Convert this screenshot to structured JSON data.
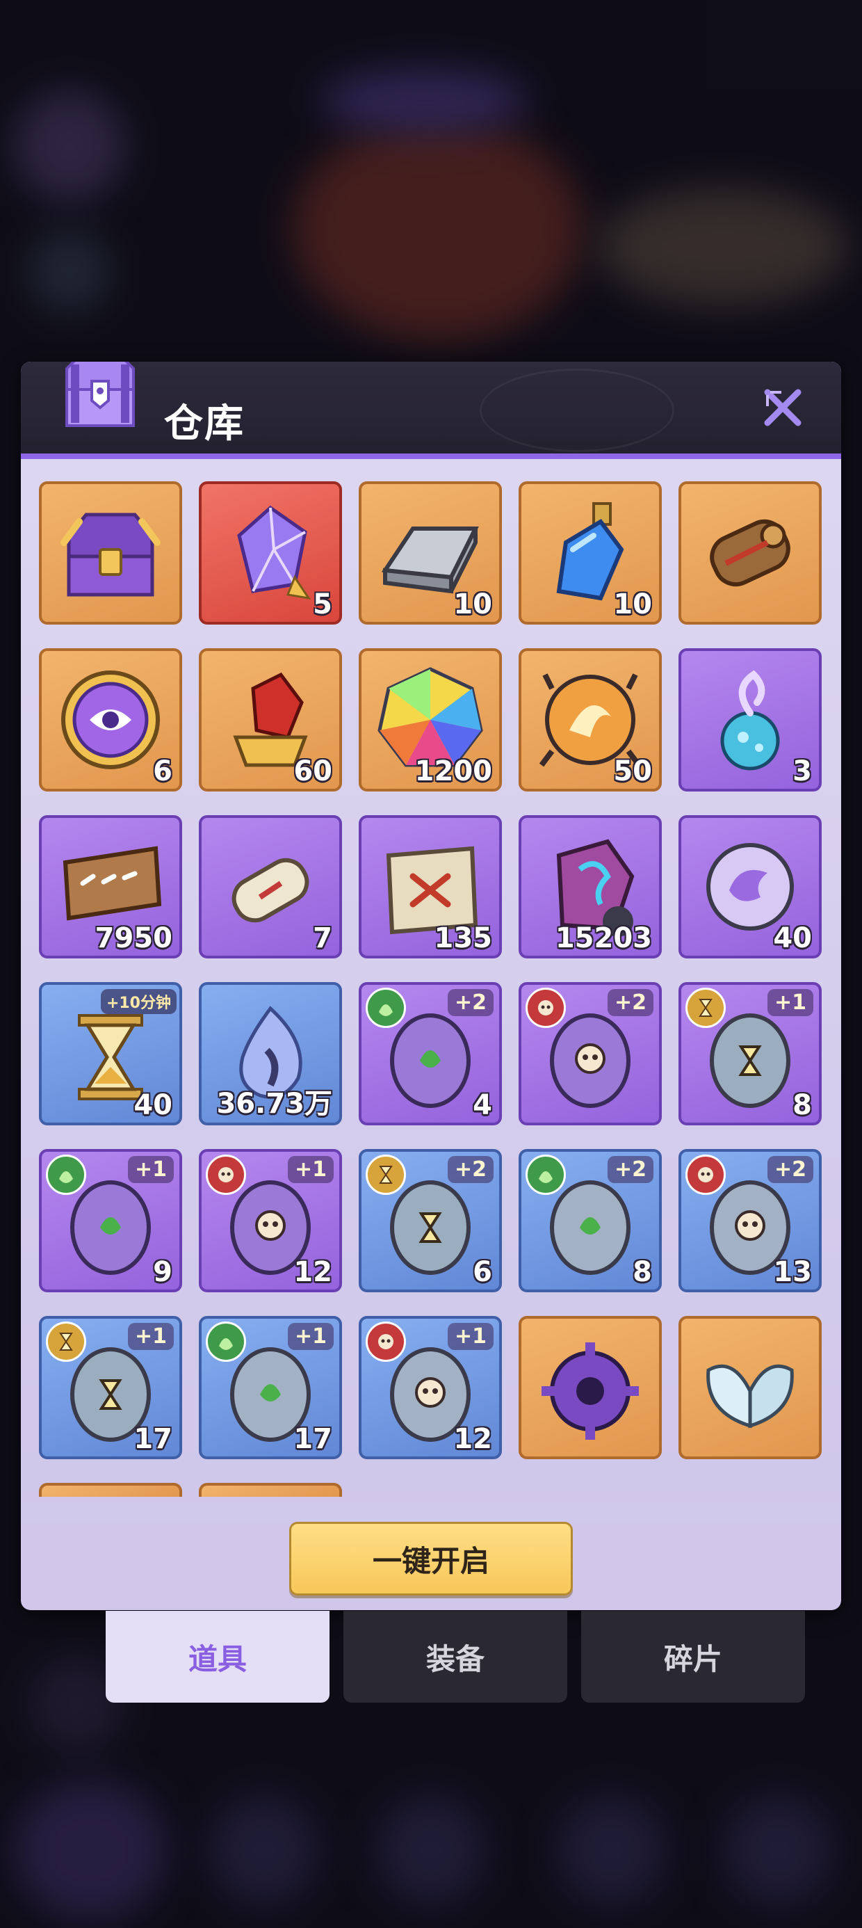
{
  "panel": {
    "title": "仓库",
    "open_all_label": "一键开启"
  },
  "items": [
    {
      "id": "r0c0",
      "bg": "orange",
      "icon": "gold-purple-chest-icon",
      "qty": ""
    },
    {
      "id": "r0c1",
      "bg": "red",
      "icon": "purple-crystal-gem-icon",
      "qty": "5"
    },
    {
      "id": "r0c2",
      "bg": "orange",
      "icon": "silver-ingot-icon",
      "qty": "10"
    },
    {
      "id": "r0c3",
      "bg": "orange",
      "icon": "blue-potion-bottle-icon",
      "qty": "10"
    },
    {
      "id": "r0c4",
      "bg": "orange",
      "icon": "leather-scroll-icon",
      "qty": ""
    },
    {
      "id": "r1c0",
      "bg": "orange",
      "icon": "purple-eye-medallion-icon",
      "qty": "6"
    },
    {
      "id": "r1c1",
      "bg": "orange",
      "icon": "red-crystal-crown-icon",
      "qty": "60"
    },
    {
      "id": "r1c2",
      "bg": "orange",
      "icon": "rainbow-gem-icon",
      "qty": "1200"
    },
    {
      "id": "r1c3",
      "bg": "orange",
      "icon": "fire-orb-icon",
      "qty": "50"
    },
    {
      "id": "r1c4",
      "bg": "purple",
      "icon": "blue-soul-flame-icon",
      "qty": "3"
    },
    {
      "id": "r2c0",
      "bg": "purple",
      "icon": "rune-banner-icon",
      "qty": "7950"
    },
    {
      "id": "r2c1",
      "bg": "purple",
      "icon": "rolled-scroll-icon",
      "qty": "7"
    },
    {
      "id": "r2c2",
      "bg": "purple",
      "icon": "treasure-map-icon",
      "qty": "135"
    },
    {
      "id": "r2c3",
      "bg": "purple",
      "icon": "purple-rune-stone-icon",
      "qty": "15203"
    },
    {
      "id": "r2c4",
      "bg": "purple",
      "icon": "swirl-orb-icon",
      "qty": "40"
    },
    {
      "id": "r3c0",
      "bg": "blue",
      "icon": "hourglass-icon",
      "qty": "40",
      "tag": "+10分钟"
    },
    {
      "id": "r3c1",
      "bg": "blue",
      "icon": "spirit-flame-icon",
      "qty": "36.73万"
    },
    {
      "id": "r3c2",
      "bg": "purple",
      "icon": "leaf-egg-icon",
      "qty": "4",
      "element": "green",
      "element_icon": "leaf-icon",
      "plus": "+2"
    },
    {
      "id": "r3c3",
      "bg": "purple",
      "icon": "skull-egg-icon",
      "qty": "",
      "element": "redc",
      "element_icon": "skull-icon",
      "plus": "+2"
    },
    {
      "id": "r3c4",
      "bg": "purple",
      "icon": "hourglass-egg-icon",
      "qty": "8",
      "element": "gold",
      "element_icon": "hourglass-small-icon",
      "plus": "+1"
    },
    {
      "id": "r4c0",
      "bg": "purple",
      "icon": "leaf-egg-icon",
      "qty": "9",
      "element": "green",
      "element_icon": "leaf-icon",
      "plus": "+1"
    },
    {
      "id": "r4c1",
      "bg": "purple",
      "icon": "skull-egg-icon",
      "qty": "12",
      "element": "redc",
      "element_icon": "skull-icon",
      "plus": "+1"
    },
    {
      "id": "r4c2",
      "bg": "blue",
      "icon": "hourglass-egg-icon",
      "qty": "6",
      "element": "gold",
      "element_icon": "hourglass-small-icon",
      "plus": "+2"
    },
    {
      "id": "r4c3",
      "bg": "blue",
      "icon": "leaf-egg-icon",
      "qty": "8",
      "element": "green",
      "element_icon": "leaf-icon",
      "plus": "+2"
    },
    {
      "id": "r4c4",
      "bg": "blue",
      "icon": "skull-egg-icon",
      "qty": "13",
      "element": "redc",
      "element_icon": "skull-icon",
      "plus": "+2"
    },
    {
      "id": "r5c0",
      "bg": "blue",
      "icon": "hourglass-egg-icon",
      "qty": "17",
      "element": "gold",
      "element_icon": "hourglass-small-icon",
      "plus": "+1"
    },
    {
      "id": "r5c1",
      "bg": "blue",
      "icon": "leaf-egg-icon",
      "qty": "17",
      "element": "green",
      "element_icon": "leaf-icon",
      "plus": "+1"
    },
    {
      "id": "r5c2",
      "bg": "blue",
      "icon": "skull-egg-icon",
      "qty": "12",
      "element": "redc",
      "element_icon": "skull-icon",
      "plus": "+1"
    },
    {
      "id": "r5c3",
      "bg": "orange",
      "icon": "purple-gear-icon",
      "qty": ""
    },
    {
      "id": "r5c4",
      "bg": "orange",
      "icon": "white-feather-wings-icon",
      "qty": ""
    }
  ],
  "tabs": [
    {
      "label": "道具",
      "active": true
    },
    {
      "label": "装备",
      "active": false
    },
    {
      "label": "碎片",
      "active": false
    }
  ],
  "colors": {
    "accent": "#8d67e6",
    "button_gold": "#f7c85a",
    "header_dark": "#24212f"
  }
}
